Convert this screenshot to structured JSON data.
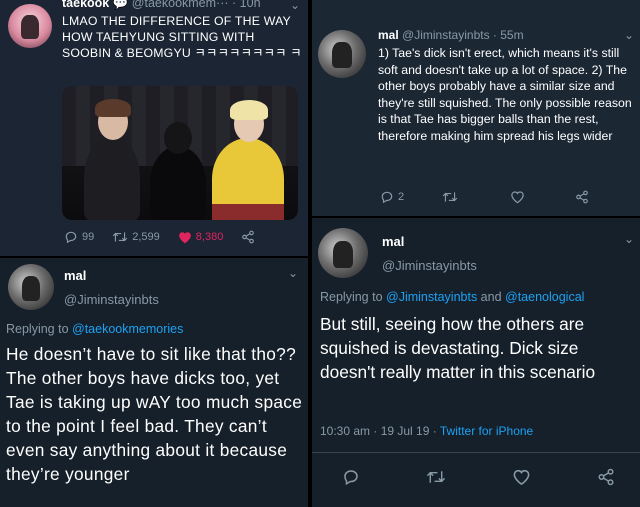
{
  "colors": {
    "accent": "#1da1f2",
    "like": "#e0245e",
    "muted": "#8899a6",
    "bg": "#15202b"
  },
  "tweet1": {
    "name": "taekook",
    "name_badge": "💬",
    "handle": "@taekookmem···",
    "time": "· 10h",
    "text": "LMAO THE DIFFERENCE OF THE WAY HOW TAEHYUNG SITTING WITH SOOBIN & BEOMGYU ㅋㅋㅋㅋㅋㅋㅋㅋ ㅋ",
    "replies": "99",
    "retweets": "2,599",
    "likes": "8,380"
  },
  "tweet2": {
    "name": "mal",
    "handle": "@Jiminstayinbts",
    "replying_label": "Replying to ",
    "replying_to": "@taekookmemories",
    "text": "He doesn’t have to sit like that tho?? The other boys have dicks too, yet Tae is taking up wAY too much space to the point I feel bad. They can’t even say anything about it because they’re younger"
  },
  "tweet3": {
    "name": "mal",
    "handle": "@Jiminstayinbts · 55m",
    "text": "1) Tae's dick isn't erect, which means it's still soft and doesn't take up a lot of space. 2) The other boys probably have a similar size and they're still squished. The only possible reason is that Tae has bigger balls than the rest, therefore making him spread his legs wider",
    "replies": "2"
  },
  "tweet4": {
    "name": "mal",
    "handle": "@Jiminstayinbts",
    "replying_label": "Replying to ",
    "replying_to_1": "@Jiminstayinbts",
    "replying_and": " and ",
    "replying_to_2": "@taenological",
    "text": "But still, seeing how the others are squished is devastating. Dick size doesn't really matter in this scenario",
    "timestamp": "10:30 am · 19 Jul 19 · ",
    "source": "Twitter for iPhone"
  }
}
